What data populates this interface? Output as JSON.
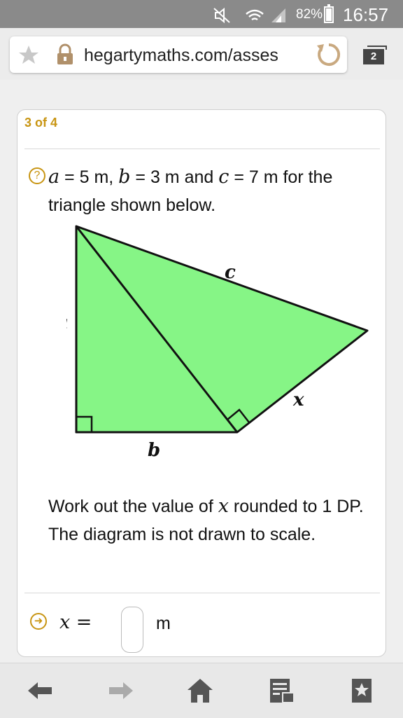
{
  "status_bar": {
    "battery": "82%",
    "time": "16:57",
    "icons": [
      "mute-icon",
      "wifi-icon",
      "signal-icon",
      "battery-icon"
    ]
  },
  "browser": {
    "url": "hegartymaths.com/asses",
    "tab_count": "2",
    "icons": [
      "star-icon",
      "lock-icon",
      "reload-icon",
      "tabs-icon"
    ]
  },
  "question": {
    "counter": "3 of 4",
    "intro": {
      "a_var": "a",
      "a_val": " = 5 m, ",
      "b_var": "b",
      "b_val": " = 3 m and ",
      "c_var": "c",
      "c_val": " = 7 m for the",
      "line2": "triangle shown below."
    },
    "diagram": {
      "label_a": "a",
      "label_b": "b",
      "label_c": "c",
      "label_x": "x",
      "fill_color": "#86f586"
    },
    "instruction_pre": "Work out the value of ",
    "instruction_var": "x",
    "instruction_post": " rounded to 1 DP.",
    "note": "The diagram is not drawn to scale.",
    "answer": {
      "label": "x =",
      "value": "",
      "unit": "m"
    }
  },
  "accent_color": "#c89513",
  "bottom_nav": [
    "back-icon",
    "forward-icon",
    "home-icon",
    "reader-icon",
    "bookmark-icon"
  ]
}
